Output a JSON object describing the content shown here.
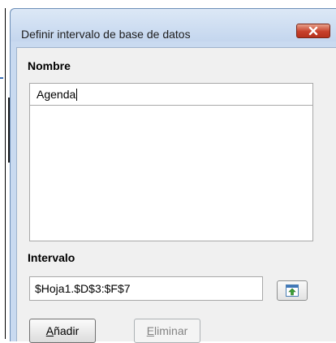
{
  "dialog": {
    "title": "Definir intervalo de base de datos",
    "name_section": {
      "label": "Nombre",
      "value": "Agenda",
      "names": []
    },
    "range_section": {
      "label": "Intervalo",
      "value": "$Hoja1.$D$3:$F$7"
    },
    "buttons": {
      "add_accel": "A",
      "add_rest": "ñadir",
      "delete_accel": "E",
      "delete_rest": "liminar"
    }
  },
  "icons": {
    "close": "close-icon",
    "shrink": "shrink-icon"
  },
  "colors": {
    "frame": "#c9daf0",
    "close_button": "#c7402a",
    "client_area": "#f0f0f0"
  }
}
